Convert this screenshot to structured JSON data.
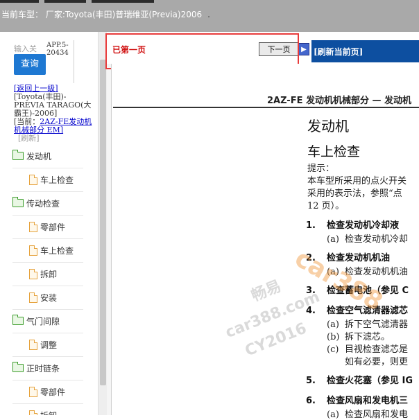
{
  "top_bar": {
    "car_label": "当前车型：  厂家:Toyota(丰田)普瑞维亚(Previa)2006",
    "dot": "."
  },
  "sidebar": {
    "input_label": "输入关",
    "query_button": "查询",
    "app_text": "APP.5-20434",
    "nav": {
      "back": "[返回上一级]",
      "model": "[Toyota(丰田)-PREVIA TARAGO(大霸王)-2006]",
      "current_prefix": "[当前：",
      "current_link": "2AZ-FE发动机机械部分 EM]",
      "refresh": "[刷新]"
    },
    "tree": [
      {
        "type": "folder",
        "label": "发动机"
      },
      {
        "type": "doc",
        "label": "车上检查"
      },
      {
        "type": "folder",
        "label": "传动检查"
      },
      {
        "type": "doc",
        "label": "零部件"
      },
      {
        "type": "doc",
        "label": "车上检查"
      },
      {
        "type": "doc",
        "label": "拆卸"
      },
      {
        "type": "doc",
        "label": "安装"
      },
      {
        "type": "folder",
        "label": "气门间隙"
      },
      {
        "type": "doc",
        "label": "调整"
      },
      {
        "type": "folder",
        "label": "正时链条"
      },
      {
        "type": "doc",
        "label": "零部件"
      },
      {
        "type": "doc",
        "label": "拆卸"
      }
    ]
  },
  "toolbar": {
    "first_page": "已第一页",
    "next_page": "下一页",
    "refresh_page": "[刷新当前页]"
  },
  "document": {
    "header": "2AZ-FE 发动机机械部分 — 发动机",
    "title": "发动机",
    "subtitle": "车上检查",
    "hint_label": "提示：",
    "hint_line1": "本车型所采用的点火开关",
    "hint_line2": "采用的表示法，参照“点",
    "hint_line3": "12 页）。",
    "steps": [
      {
        "num": "1.",
        "text": "检查发动机冷却液",
        "subs": [
          {
            "mark": "(a)",
            "text": "检查发动机冷却"
          }
        ]
      },
      {
        "num": "2.",
        "text": "检查发动机机油",
        "subs": [
          {
            "mark": "(a)",
            "text": "检查发动机机油"
          }
        ]
      },
      {
        "num": "3.",
        "text": "检查蓄电池（参见 C",
        "subs": []
      },
      {
        "num": "4.",
        "text": "检查空气滤清器滤芯",
        "subs": [
          {
            "mark": "(a)",
            "text": "拆下空气滤清器"
          },
          {
            "mark": "(b)",
            "text": "拆下滤芯。"
          },
          {
            "mark": "(c)",
            "text": "目视检查滤芯是"
          },
          {
            "mark": "",
            "text": "如有必要，则更"
          }
        ]
      },
      {
        "num": "5.",
        "text": "检查火花塞（参见 IG",
        "subs": []
      },
      {
        "num": "6.",
        "text": "检查风扇和发电机三",
        "subs": [
          {
            "mark": "(a)",
            "text": "检查风扇和发电"
          }
        ]
      }
    ],
    "watermarks": [
      "畅易",
      "car388.com",
      "CY2016"
    ],
    "watermark_logo": "car388"
  },
  "colors": {
    "accent": "#0d4fa0",
    "query_button": "#1e78d2",
    "highlight": "#e83b3b",
    "first_page": "#d01010"
  }
}
